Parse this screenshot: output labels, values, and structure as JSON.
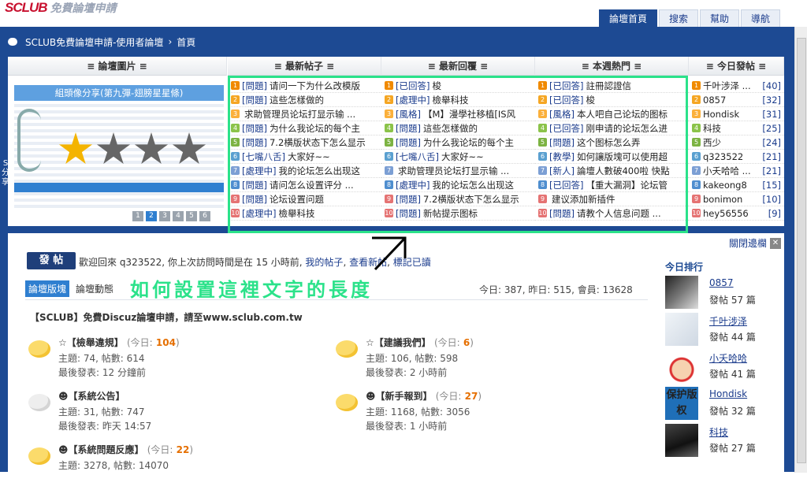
{
  "logo": {
    "brand": "SCLUB",
    "text": "免費論壇申請"
  },
  "topnav": [
    "論壇首頁",
    "搜索",
    "幫助",
    "導航"
  ],
  "breadcrumb": {
    "site": "SCLUB免費論壇申請-使用者論壇",
    "sep": "›",
    "current": "首頁"
  },
  "sidetab": "S 分享",
  "portal": {
    "pics": {
      "header": "≡ 論壇圖片 ≡",
      "caption": "組頭像分享(第九彈-翅膀星星條)",
      "pages": [
        "1",
        "2",
        "3",
        "4",
        "5",
        "6"
      ]
    },
    "newposts": {
      "header": "≡ 最新帖子 ≡",
      "items": [
        {
          "tag": "[問題]",
          "title": "请问一下为什么改模版"
        },
        {
          "tag": "[問題]",
          "title": "這些怎樣做的"
        },
        {
          "tag": "",
          "title": "求助管理员论坛打显示输 ..."
        },
        {
          "tag": "[問題]",
          "title": "为什么我论坛的每个主"
        },
        {
          "tag": "[問題]",
          "title": "7.2横版状态下怎么显示"
        },
        {
          "tag": "[七嘴八舌]",
          "title": "大家好~~"
        },
        {
          "tag": "[處理中]",
          "title": "我的论坛怎么出现这"
        },
        {
          "tag": "[問題]",
          "title": "请问怎么设置评分 ..."
        },
        {
          "tag": "[問題]",
          "title": "论坛设置问题"
        },
        {
          "tag": "[處理中]",
          "title": "檢舉科技"
        }
      ]
    },
    "newreplies": {
      "header": "≡ 最新回覆 ≡",
      "items": [
        {
          "tag": "[已回答]",
          "title": "梭"
        },
        {
          "tag": "[處理中]",
          "title": "檢舉科技"
        },
        {
          "tag": "[風格]",
          "title": "【M】漫學社移植[IS风"
        },
        {
          "tag": "[問題]",
          "title": "這些怎樣做的"
        },
        {
          "tag": "[問題]",
          "title": "为什么我论坛的每个主"
        },
        {
          "tag": "[七嘴八舌]",
          "title": "大家好~~"
        },
        {
          "tag": "",
          "title": "求助管理员论坛打显示输 ..."
        },
        {
          "tag": "[處理中]",
          "title": "我的论坛怎么出现这"
        },
        {
          "tag": "[問題]",
          "title": "7.2横版状态下怎么显示"
        },
        {
          "tag": "[問題]",
          "title": "新帖提示图标"
        }
      ]
    },
    "hot": {
      "header": "≡ 本週熱門 ≡",
      "items": [
        {
          "tag": "[已回答]",
          "title": "註冊認證信"
        },
        {
          "tag": "[已回答]",
          "title": "梭"
        },
        {
          "tag": "[風格]",
          "title": "本人吧自己论坛的图标"
        },
        {
          "tag": "[已回答]",
          "title": "刚申请的论坛怎么进"
        },
        {
          "tag": "[問題]",
          "title": "这个图标怎么弄"
        },
        {
          "tag": "[教學]",
          "title": "如何讓版塊可以使用超"
        },
        {
          "tag": "[新人]",
          "title": "論壇人數破400啦 快點"
        },
        {
          "tag": "[已回答]",
          "title": "【重大漏洞】论坛管"
        },
        {
          "tag": "",
          "title": "建议添加新插件"
        },
        {
          "tag": "[問題]",
          "title": "请教个人信息问题 ..."
        }
      ]
    },
    "today": {
      "header": "≡ 今日發帖 ≡",
      "items": [
        {
          "name": "千叶涉泽 ...",
          "count": "[40]"
        },
        {
          "name": "0857",
          "count": "[32]"
        },
        {
          "name": "Hondisk",
          "count": "[31]"
        },
        {
          "name": "科技",
          "count": "[25]"
        },
        {
          "name": "西少",
          "count": "[24]"
        },
        {
          "name": "q323522",
          "count": "[21]"
        },
        {
          "name": "小夭哈哈 ...",
          "count": "[21]"
        },
        {
          "name": "kakeong8",
          "count": "[15]"
        },
        {
          "name": "bonimon",
          "count": "[10]"
        },
        {
          "name": "hey56556",
          "count": "[9]"
        }
      ]
    }
  },
  "main": {
    "post_button": "發 帖",
    "welcome_a": "歡迎回來 q323522, 你上次訪問時間是在 15 小時前,",
    "my_posts": "我的帖子",
    "view_new": "查看新帖",
    "mark_read": "標記已讀",
    "tab_forums": "論壇版塊",
    "tab_activity": "論壇動態",
    "annotation": "如何設置這裡文字的長度",
    "stats": "今日: 387, 昨日: 515, 會員: 13628",
    "announcement": "【SCLUB】免費Discuz論壇申請，請至www.sclub.com.tw",
    "forums": [
      {
        "name": "☆【檢舉違規】",
        "today_label": "(今日:",
        "today": "104",
        "close": ")",
        "topics": "主題: 74, 帖數: 614",
        "last": "最後發表: 12 分鐘前"
      },
      {
        "name": "☆【建議我們】",
        "today_label": "(今日:",
        "today": "6",
        "close": ")",
        "topics": "主題: 106, 帖數: 598",
        "last": "最後發表: 2 小時前"
      },
      {
        "name": "☻【系統公告】",
        "today_label": "",
        "today": "",
        "close": "",
        "topics": "主題: 31, 帖數: 747",
        "last": "最後發表: 昨天 14:57"
      },
      {
        "name": "☻【新手報到】",
        "today_label": "(今日:",
        "today": "27",
        "close": ")",
        "topics": "主題: 1168, 帖數: 3056",
        "last": "最後發表: 1 小時前"
      },
      {
        "name": "☻【系統問題反應】",
        "today_label": "(今日:",
        "today": "22",
        "close": ")",
        "topics": "主題: 3278, 帖數: 14070",
        "last": ""
      }
    ]
  },
  "right": {
    "close_label": "關閉邊欄",
    "rank_title": "今日排行",
    "ranks": [
      {
        "name": "0857",
        "posts": "發帖 57 篇"
      },
      {
        "name": "千叶涉泽",
        "posts": "發帖 44 篇"
      },
      {
        "name": "小夭哈哈",
        "posts": "發帖 41 篇"
      },
      {
        "name": "Hondisk",
        "posts": "發帖 32 篇"
      },
      {
        "name": "科技",
        "posts": "發帖 27 篇"
      }
    ],
    "avatar4_text": "保护版权"
  },
  "colors": {
    "brand_blue": "#1d4a93",
    "annotation_green": "#2be28a",
    "accent_orange": "#e56f00"
  }
}
